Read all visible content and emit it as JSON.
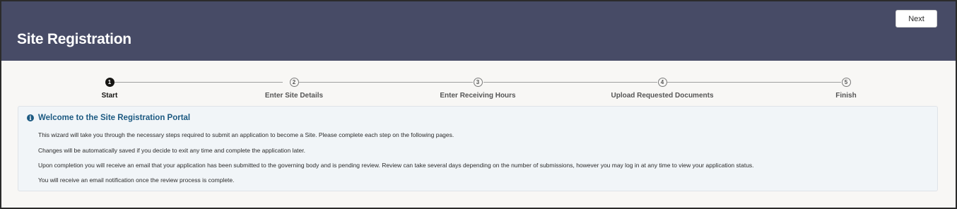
{
  "header": {
    "title": "Site Registration",
    "next_label": "Next",
    "background": "#474b66"
  },
  "train": {
    "current_index": 0,
    "stops": [
      {
        "number": "1",
        "label": "Start"
      },
      {
        "number": "2",
        "label": "Enter Site Details"
      },
      {
        "number": "3",
        "label": "Enter Receiving Hours"
      },
      {
        "number": "4",
        "label": "Upload Requested Documents"
      },
      {
        "number": "5",
        "label": "Finish"
      }
    ]
  },
  "info": {
    "icon": "info-icon",
    "title": "Welcome to the Site Registration Portal",
    "paragraphs": [
      "This wizard will take you through the necessary steps required to submit an application to become a Site. Please complete each step on the following pages.",
      "Changes will be automatically saved if you decide to exit any time and complete the application later.",
      "Upon completion you will receive an email that your application has been submitted to the governing body and is pending review. Review can take several days depending on the number of submissions, however you may log in at any time to view your application status.",
      "You will receive an email notification once the review process is complete."
    ]
  },
  "colors": {
    "accent": "#1c5a82",
    "banner_yellow": "#f2c14e",
    "banner_blue": "#6b7bb8"
  }
}
